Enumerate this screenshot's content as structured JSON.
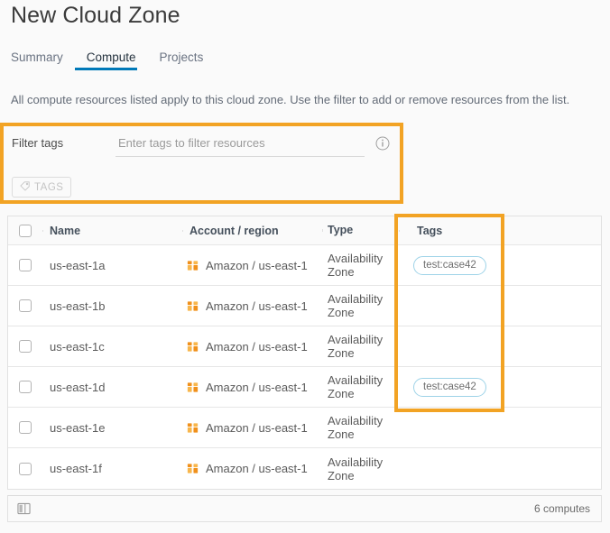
{
  "header": {
    "title": "New Cloud Zone"
  },
  "tabs": [
    {
      "label": "Summary",
      "active": false
    },
    {
      "label": "Compute",
      "active": true
    },
    {
      "label": "Projects",
      "active": false
    }
  ],
  "description": "All compute resources listed apply to this cloud zone. Use the filter to add or remove resources from the list.",
  "filter": {
    "label": "Filter tags",
    "placeholder": "Enter tags to filter resources",
    "value": "",
    "info_icon": "info-circle-icon",
    "tags_button": {
      "label": "TAGS",
      "icon": "tag-icon",
      "disabled": true
    }
  },
  "highlights": {
    "color": "#f2a324",
    "regions": [
      "filter-tags-section",
      "tags-column"
    ]
  },
  "table": {
    "columns": [
      "",
      "Name",
      "Account / region",
      "Type",
      "Tags",
      ""
    ],
    "account_icon": "aws-cube-icon",
    "rows": [
      {
        "name": "us-east-1a",
        "account": "Amazon / us-east-1",
        "type": "Availability Zone",
        "tags": [
          "test:case42"
        ],
        "selected": false
      },
      {
        "name": "us-east-1b",
        "account": "Amazon / us-east-1",
        "type": "Availability Zone",
        "tags": [],
        "selected": false
      },
      {
        "name": "us-east-1c",
        "account": "Amazon / us-east-1",
        "type": "Availability Zone",
        "tags": [],
        "selected": false
      },
      {
        "name": "us-east-1d",
        "account": "Amazon / us-east-1",
        "type": "Availability Zone",
        "tags": [
          "test:case42"
        ],
        "selected": false
      },
      {
        "name": "us-east-1e",
        "account": "Amazon / us-east-1",
        "type": "Availability Zone",
        "tags": [],
        "selected": false
      },
      {
        "name": "us-east-1f",
        "account": "Amazon / us-east-1",
        "type": "Availability Zone",
        "tags": [],
        "selected": false
      }
    ]
  },
  "footer": {
    "columns_icon": "column-layout-icon",
    "count_label": "6 computes"
  },
  "colors": {
    "accent_blue": "#0079b8",
    "highlight_orange": "#f2a324",
    "aws_orange": "#f08c1b",
    "chip_border": "#9ed3e8"
  }
}
